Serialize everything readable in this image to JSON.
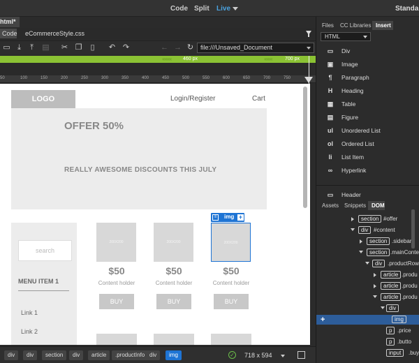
{
  "topbar": {
    "views": [
      "Code",
      "Split",
      "Live"
    ],
    "active_view": "Live",
    "workspace": "Standard"
  },
  "document": {
    "tab": "html*",
    "related_files": [
      "Code",
      "eCommerceStyle.css"
    ],
    "url": "file:///Unsaved_Document"
  },
  "toolbar": {
    "icons": [
      "folder-icon",
      "download-icon",
      "upload-icon",
      "print-icon",
      "scissors-icon",
      "copy-icon",
      "paste-icon",
      "undo-icon",
      "redo-icon",
      "back-icon",
      "forward-icon",
      "refresh-icon"
    ]
  },
  "media_query": {
    "label_1": "460 px",
    "label_2": "700 px",
    "color": "#8bc234"
  },
  "ruler": {
    "labels": [
      "50",
      "100",
      "150",
      "200",
      "250",
      "300",
      "350",
      "400",
      "450",
      "500",
      "550",
      "600",
      "650",
      "700",
      "750"
    ]
  },
  "page": {
    "logo": "LOGO",
    "nav": [
      "Login/Register",
      "Cart"
    ],
    "offer_title": "OFFER 50%",
    "offer_sub": "REALLY AWESOME DISCOUNTS THIS JULY",
    "search_placeholder": "search",
    "menu_item": "MENU ITEM 1",
    "links": [
      "Link 1",
      "Link 2"
    ],
    "products": [
      {
        "img": "200X200",
        "price": "$50",
        "holder": "Content holder",
        "buy": "BUY"
      },
      {
        "img": "200X200",
        "price": "$50",
        "holder": "Content holder",
        "buy": "BUY"
      },
      {
        "img": "200X200",
        "price": "$50",
        "holder": "Content holder",
        "buy": "BUY"
      }
    ],
    "element_tag": "img",
    "element_tag_plus": "+"
  },
  "statusbar": {
    "breadcrumbs": [
      "div",
      "div",
      "section",
      "div",
      "article",
      ".productInfo",
      "div",
      "img"
    ],
    "active_crumb": "img",
    "dimensions": "718 x 594",
    "accent": "#1e74d4"
  },
  "panel": {
    "tabs": [
      "Files",
      "CC Libraries",
      "Insert"
    ],
    "active_tab": "Insert",
    "category": "HTML",
    "insert_items": [
      {
        "icon": "div-icon",
        "glyph": "▭",
        "label": "Div"
      },
      {
        "icon": "image-icon",
        "glyph": "▣",
        "label": "Image"
      },
      {
        "icon": "paragraph-icon",
        "glyph": "¶",
        "label": "Paragraph"
      },
      {
        "icon": "heading-icon",
        "glyph": "H",
        "label": "Heading"
      },
      {
        "icon": "table-icon",
        "glyph": "▦",
        "label": "Table"
      },
      {
        "icon": "figure-icon",
        "glyph": "▤",
        "label": "Figure"
      },
      {
        "icon": "unordered-list-icon",
        "glyph": "ul",
        "label": "Unordered List"
      },
      {
        "icon": "ordered-list-icon",
        "glyph": "ol",
        "label": "Ordered List"
      },
      {
        "icon": "list-item-icon",
        "glyph": "li",
        "label": "List Item"
      },
      {
        "icon": "hyperlink-icon",
        "glyph": "∞",
        "label": "Hyperlink"
      },
      {
        "icon": "header-icon",
        "glyph": "▭",
        "label": "Header"
      }
    ],
    "tabs2": [
      "Assets",
      "Snippets",
      "DOM"
    ],
    "active_tab2": "DOM",
    "dom": [
      {
        "tag": "section",
        "attr": "#offer",
        "tw": "r"
      },
      {
        "tag": "div",
        "attr": "#content",
        "tw": "d"
      },
      {
        "tag": "section",
        "attr": ".sidebar",
        "tw": "r"
      },
      {
        "tag": "section",
        "attr": ".mainConte",
        "tw": "d"
      },
      {
        "tag": "div",
        "attr": ".productRow",
        "tw": "d"
      },
      {
        "tag": "article",
        "attr": ".produ",
        "tw": "r"
      },
      {
        "tag": "article",
        "attr": ".produ",
        "tw": "r"
      },
      {
        "tag": "article",
        "attr": ".produ",
        "tw": "d"
      },
      {
        "tag": "div",
        "attr": "",
        "tw": "d"
      },
      {
        "tag": "img",
        "attr": "",
        "tw": ""
      },
      {
        "tag": "p",
        "attr": ".price",
        "tw": ""
      },
      {
        "tag": "p",
        "attr": ".butto",
        "tw": ""
      },
      {
        "tag": "input",
        "attr": ".buyB",
        "tw": ""
      }
    ],
    "dom_plus": "+"
  }
}
